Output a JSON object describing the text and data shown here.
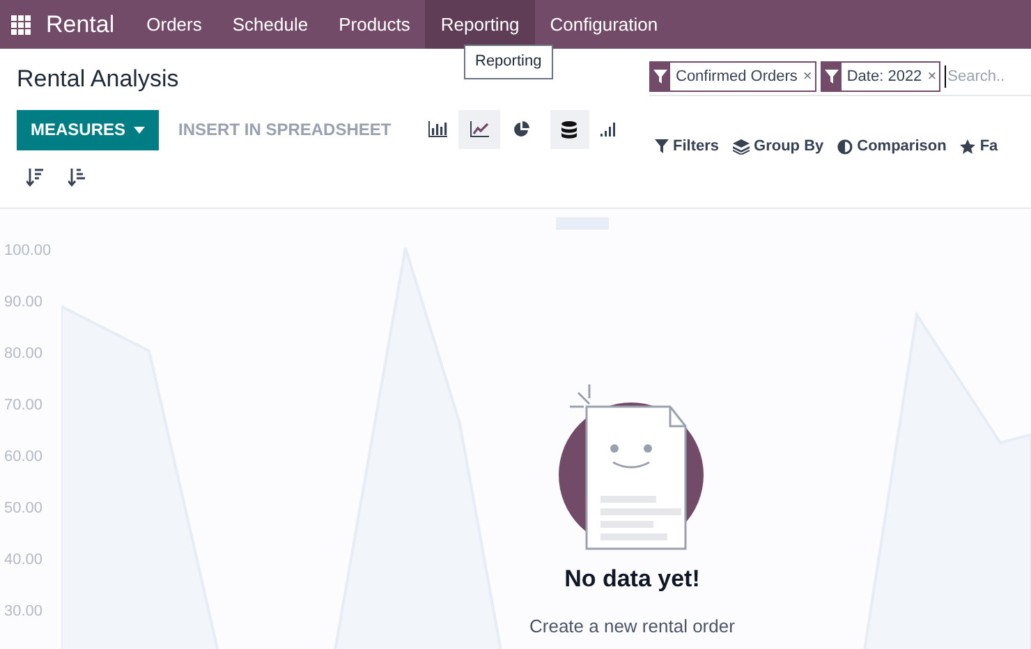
{
  "navbar": {
    "app_name": "Rental",
    "menu": [
      {
        "label": "Orders",
        "highlighted": false
      },
      {
        "label": "Schedule",
        "highlighted": false
      },
      {
        "label": "Products",
        "highlighted": false
      },
      {
        "label": "Reporting",
        "highlighted": true
      },
      {
        "label": "Configuration",
        "highlighted": false
      }
    ],
    "tooltip": "Reporting"
  },
  "page_title": "Rental Analysis",
  "search": {
    "facets": [
      {
        "label": "Confirmed Orders",
        "remove": "×"
      },
      {
        "label": "Date: 2022",
        "remove": "×"
      }
    ],
    "placeholder": "Search.."
  },
  "toolbar": {
    "measures": "MEASURES",
    "insert": "INSERT IN SPREADSHEET",
    "chart_types": [
      {
        "kind": "bar",
        "selected": false
      },
      {
        "kind": "line",
        "selected": true
      },
      {
        "kind": "pie",
        "selected": false
      }
    ],
    "toggles": [
      {
        "kind": "stacked",
        "on": true
      },
      {
        "kind": "cumulative",
        "on": false
      }
    ],
    "sorts": [
      {
        "kind": "descending"
      },
      {
        "kind": "ascending"
      }
    ]
  },
  "search_panel": [
    {
      "kind": "filters",
      "label": "Filters"
    },
    {
      "kind": "group_by",
      "label": "Group By"
    },
    {
      "kind": "comparison",
      "label": "Comparison"
    },
    {
      "kind": "favorites",
      "label": "Fa"
    }
  ],
  "sample_chart": {
    "yticks": [
      "100.00",
      "90.00",
      "80.00",
      "70.00",
      "60.00",
      "50.00",
      "40.00",
      "30.00"
    ]
  },
  "empty_state": {
    "title": "No data yet!",
    "message": "Create a new rental order"
  }
}
